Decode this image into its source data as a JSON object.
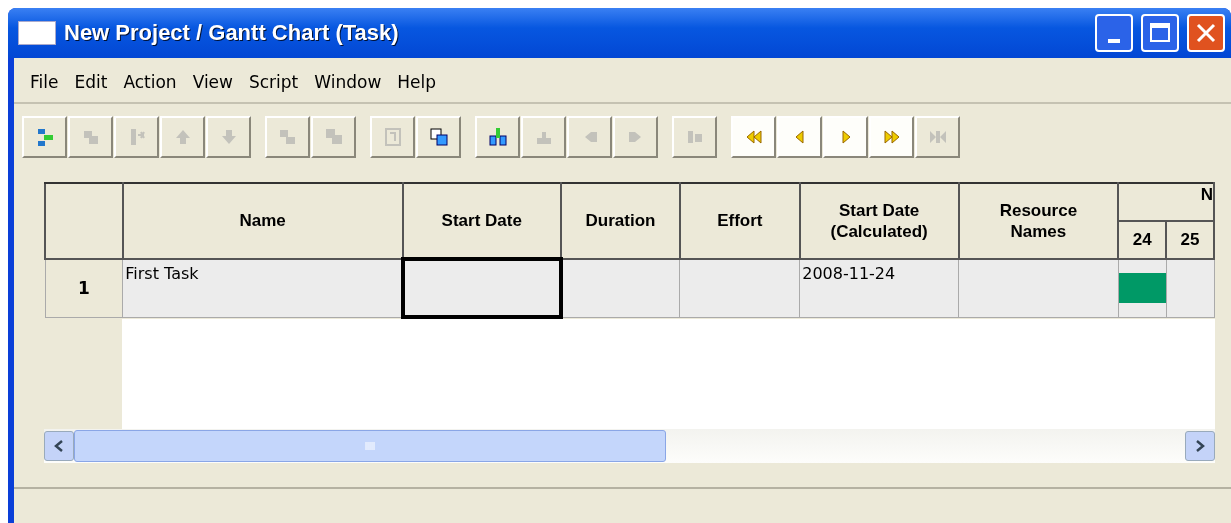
{
  "window": {
    "title": "New Project / Gantt Chart (Task)"
  },
  "menu": [
    {
      "label": "File"
    },
    {
      "label": "Edit"
    },
    {
      "label": "Action"
    },
    {
      "label": "View"
    },
    {
      "label": "Script"
    },
    {
      "label": "Window"
    },
    {
      "label": "Help"
    }
  ],
  "toolbar": [
    [
      {
        "disabled": false
      },
      {
        "disabled": true
      },
      {
        "disabled": true
      },
      {
        "disabled": true
      },
      {
        "disabled": true
      }
    ],
    [
      {
        "disabled": true
      },
      {
        "disabled": true
      }
    ],
    [
      {
        "disabled": true
      },
      {
        "disabled": false
      }
    ],
    [
      {
        "disabled": false
      },
      {
        "disabled": true
      },
      {
        "disabled": true
      },
      {
        "disabled": true
      }
    ],
    [
      {
        "disabled": true
      }
    ],
    [
      {
        "disabled": false
      },
      {
        "disabled": false
      },
      {
        "disabled": false
      },
      {
        "disabled": false
      },
      {
        "disabled": true
      }
    ]
  ],
  "table": {
    "columns": [
      "Name",
      "Start Date",
      "Duration",
      "Effort",
      "Start Date (Calculated)",
      "Resource Names"
    ],
    "gantt_header": {
      "month": "N",
      "days": [
        "24",
        "25"
      ]
    },
    "rows": [
      {
        "number": "1",
        "cells": [
          {
            "text": "First Task",
            "selected": false
          },
          {
            "text": "",
            "selected": true
          },
          {
            "text": "",
            "selected": false
          },
          {
            "text": "",
            "selected": false
          },
          {
            "text": "2008-11-24",
            "selected": false
          },
          {
            "text": "",
            "selected": false
          }
        ],
        "gantt": [
          {
            "bar": true
          },
          {
            "bar": false
          }
        ]
      }
    ]
  }
}
